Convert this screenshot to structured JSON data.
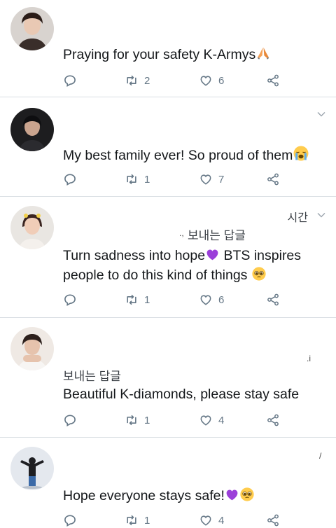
{
  "tweets": [
    {
      "text": "Praying for your safety K-Armys",
      "emoji": "pray",
      "retweets": "2",
      "likes": "6"
    },
    {
      "text": "My best family ever! So proud of them",
      "emoji": "crying-face",
      "retweets": "1",
      "likes": "7"
    },
    {
      "korean_label": "보내는 답글",
      "korean_partial": "시간",
      "text_line1": "Turn sadness into hope",
      "text_line1_after": " BTS inspires",
      "text_line2": "people to do this kind of things",
      "retweets": "1",
      "likes": "6"
    },
    {
      "korean_label": "보내는 답글",
      "text": "Beautiful K-diamonds, please stay safe",
      "retweets": "1",
      "likes": "4"
    },
    {
      "text": "Hope everyone stays safe!",
      "retweets": "1",
      "likes": "4"
    }
  ],
  "colors": {
    "action_gray": "#657786",
    "heart_purple": "#9b3fd9",
    "divider": "#d9dee3"
  },
  "icons": [
    "reply-icon",
    "retweet-icon",
    "like-icon",
    "share-icon",
    "chevron-down-icon"
  ]
}
